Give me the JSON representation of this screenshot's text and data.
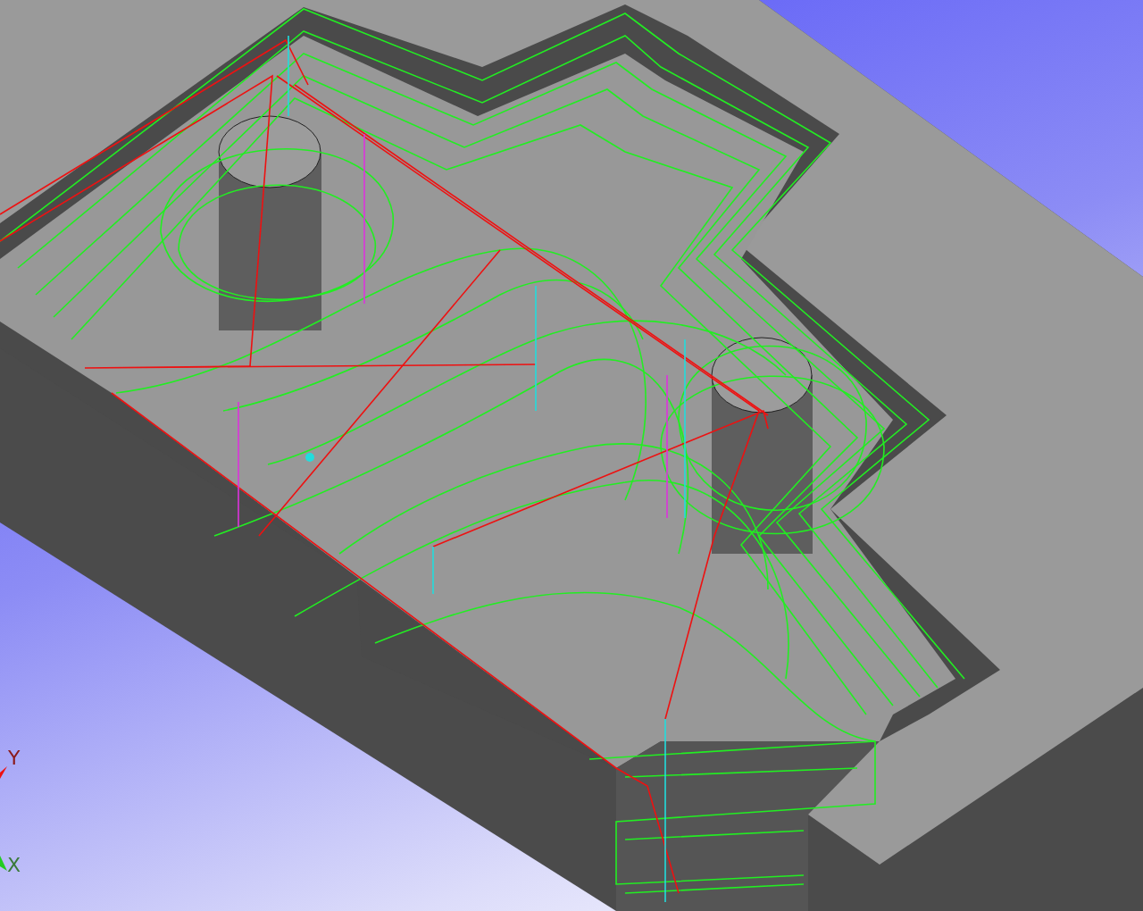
{
  "viewport": {
    "axes": [
      {
        "label": "Y",
        "color": "#8b1a1a"
      },
      {
        "label": "X",
        "color": "#3a7a3a"
      }
    ]
  }
}
